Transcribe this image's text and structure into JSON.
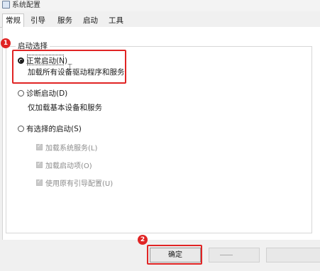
{
  "window": {
    "title": "系统配置"
  },
  "tabs": [
    {
      "label": "常规",
      "active": true
    },
    {
      "label": "引导",
      "active": false
    },
    {
      "label": "服务",
      "active": false
    },
    {
      "label": "启动",
      "active": false
    },
    {
      "label": "工具",
      "active": false
    }
  ],
  "startup_group": {
    "legend": "启动选择",
    "options": [
      {
        "label": "正常启动(N)",
        "description": "加载所有设备驱动程序和服务",
        "selected": true
      },
      {
        "label": "诊断启动(D)",
        "description": "仅加载基本设备和服务",
        "selected": false
      },
      {
        "label": "有选择的启动(S)",
        "selected": false
      }
    ],
    "sub_options": [
      {
        "label": "加载系统服务(L)",
        "checked": true,
        "disabled": true
      },
      {
        "label": "加载启动项(O)",
        "checked": true,
        "disabled": true
      },
      {
        "label": "使用原有引导配置(U)",
        "checked": true,
        "disabled": true
      }
    ]
  },
  "buttons": {
    "ok_label": "确定"
  },
  "annotations": {
    "step1": "1",
    "step2": "2",
    "highlight_color": "#e02424"
  }
}
